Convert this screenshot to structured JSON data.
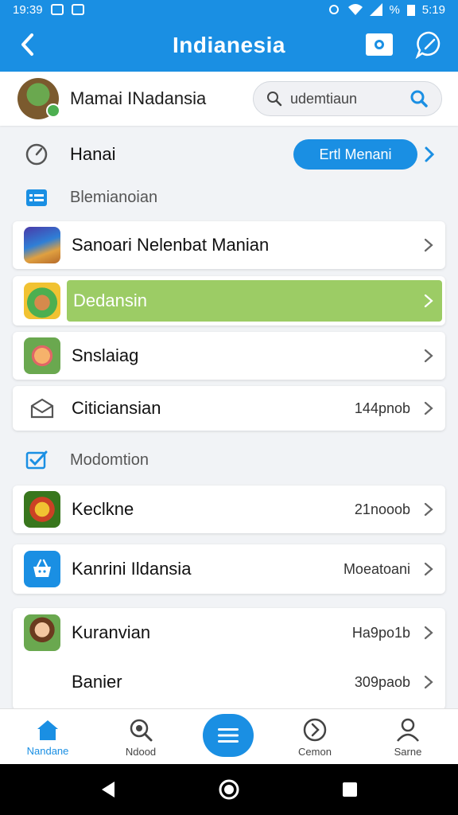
{
  "status_bar": {
    "time": "19:39",
    "battery_text": "%",
    "clock_right": "5:19"
  },
  "app_bar": {
    "title": "Indianesia"
  },
  "profile": {
    "name": "Mamai INadansia",
    "search_text": "udemtiaun"
  },
  "home": {
    "label": "Hanai",
    "button_label": "Ertl Menani"
  },
  "section1": {
    "label": "Blemianoian"
  },
  "section2": {
    "label": "Modomtion"
  },
  "items1": [
    {
      "title": "Sanoari Nelenbat Manian",
      "meta": ""
    },
    {
      "title": "Dedansin",
      "meta": ""
    },
    {
      "title": "Snslaiag",
      "meta": ""
    },
    {
      "title": "Citiciansian",
      "meta": "144pnob"
    }
  ],
  "items2": [
    {
      "title": "Keclkne",
      "meta": "21nooob"
    },
    {
      "title": "Kanrini Ildansia",
      "meta": "Moeatoani"
    }
  ],
  "items3": [
    {
      "title": "Kuranvian",
      "meta": "Ha9po1b"
    },
    {
      "title": "Banier",
      "meta": "309paob"
    }
  ],
  "nav": {
    "home": "Nandane",
    "search": "Ndood",
    "comment": "Cemon",
    "profile": "Sarne"
  },
  "colors": {
    "primary": "#1a8fe3",
    "highlight": "#9ccc65"
  }
}
